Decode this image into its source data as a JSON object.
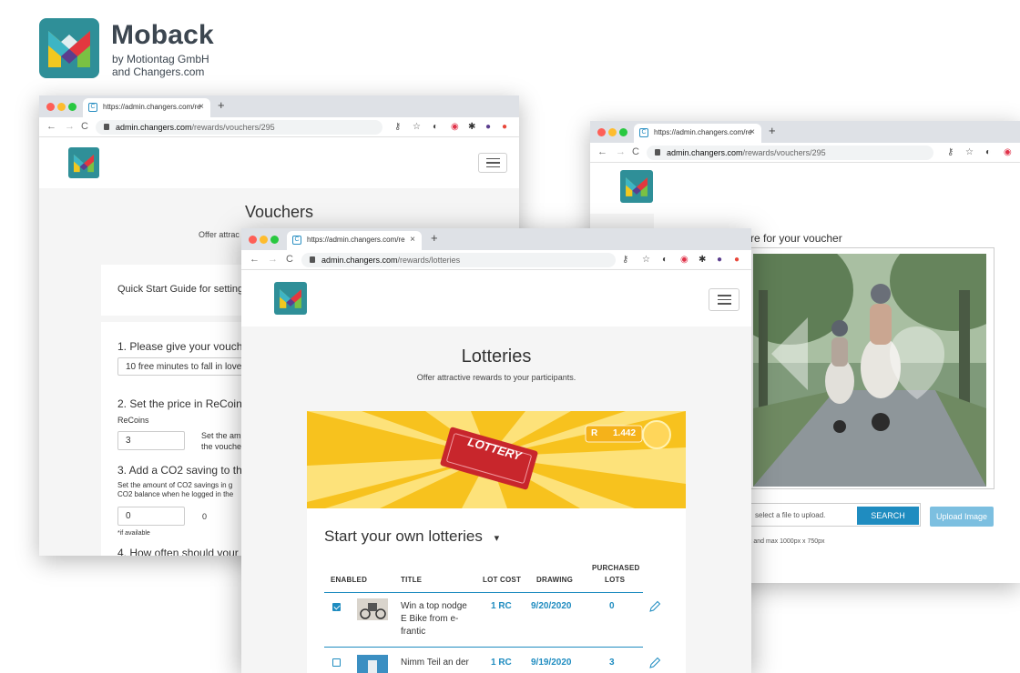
{
  "brand": {
    "name": "Moback",
    "sub1": "by Motiontag GmbH",
    "sub2": "and Changers.com"
  },
  "browser": {
    "tab_title": "https://admin.changers.com/re",
    "new_tab": "+",
    "close": "×"
  },
  "left_window": {
    "url_host": "admin.changers.com",
    "url_path": "/rewards/vouchers/295",
    "page_title": "Vouchers",
    "subtitle": "Offer attrac",
    "guide": "Quick Start Guide for setting",
    "step1": "1. Please give your voucher",
    "step1_value": "10 free minutes to fall in love wi",
    "step2": "2. Set the price in ReCoins",
    "recoins_label": "ReCoins",
    "recoins_value": "3",
    "recoins_help1": "Set the am",
    "recoins_help2": "the vouche",
    "step3": "3. Add a CO2 saving to this",
    "co2_help1": "Set the amount of CO2 savings in g",
    "co2_help2": "CO2 balance when he logged in the",
    "co2_value": "0",
    "co2_value2": "0",
    "if_available": "*if available",
    "step4": "4. How often should your p"
  },
  "right_window": {
    "url_host": "admin.changers.com",
    "url_path": "/rewards/vouchers/295",
    "picture_heading": "re for your voucher",
    "file_placeholder": "select a file to upload.",
    "search_button": "SEARCH",
    "upload_button": "Upload Image",
    "size_hint": "px and max 1000px x 750px"
  },
  "center_window": {
    "url_host": "admin.changers.com",
    "url_path": "/rewards/lotteries",
    "page_title": "Lotteries",
    "subtitle": "Offer attractive rewards to your participants.",
    "banner_ticket": "LOTTERY",
    "banner_coin_symbol": "R",
    "banner_balance": "1.442",
    "section_title": "Start your own lotteries",
    "dropdown_caret": "▾",
    "columns": {
      "enabled": "ENABLED",
      "title": "TITLE",
      "lot_cost": "LOT COST",
      "drawing": "DRAWING",
      "purchased1": "PURCHASED",
      "purchased2": "LOTS"
    },
    "rows": [
      {
        "title1": "Win a top nodge",
        "title2": "E Bike from e-",
        "title3": "frantic",
        "cost": "1 RC",
        "drawing": "9/20/2020",
        "purchased": "0"
      },
      {
        "title1": "Nimm Teil an der",
        "title2": "",
        "title3": "",
        "cost": "1 RC",
        "drawing": "9/19/2020",
        "purchased": "3"
      }
    ]
  },
  "colors": {
    "teal": "#2f8f98",
    "blue": "#1f8cc0",
    "banner_yellow": "#f7c21e",
    "banner_red": "#c8262c"
  }
}
